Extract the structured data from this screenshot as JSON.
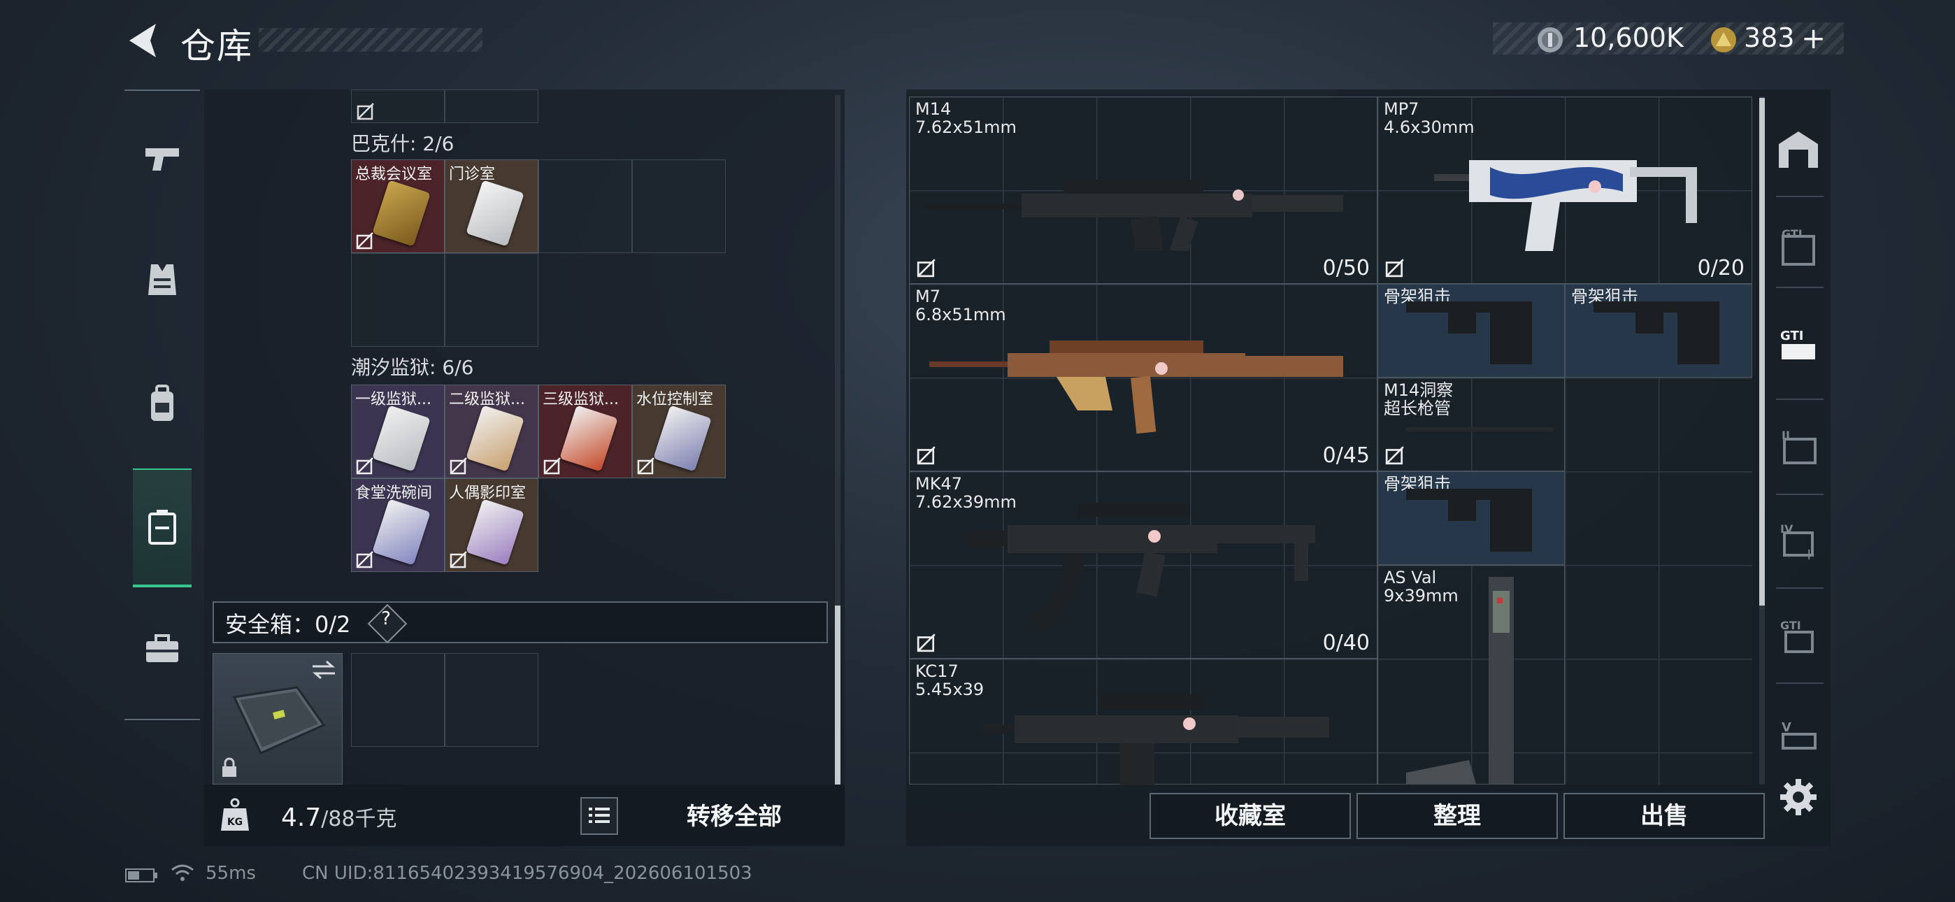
{
  "header": {
    "title": "仓库",
    "currency": [
      {
        "icon": "silver-coin-icon",
        "amount": "10,600K"
      },
      {
        "icon": "gold-coin-icon",
        "amount": "383"
      },
      {
        "add": "+"
      }
    ]
  },
  "left_nav": [
    "pistol-icon",
    "vest-icon",
    "backpack-icon",
    "container-icon",
    "toolbox-icon"
  ],
  "groups": [
    {
      "title": "巴克什: 2/6",
      "items": [
        {
          "label": "总裁会议室",
          "color": "red"
        },
        {
          "label": "门诊室",
          "color": "brown"
        }
      ]
    },
    {
      "title": "潮汐监狱: 6/6",
      "items": [
        {
          "label": "一级监狱...",
          "color": "purple"
        },
        {
          "label": "二级监狱...",
          "color": "purple"
        },
        {
          "label": "三级监狱...",
          "color": "red"
        },
        {
          "label": "水位控制室",
          "color": "brown"
        },
        {
          "label": "食堂洗碗间",
          "color": "purple"
        },
        {
          "label": "人偶影印室",
          "color": "brown"
        }
      ]
    }
  ],
  "safe_box": {
    "label": "安全箱：0/2",
    "help": "?"
  },
  "weight": {
    "current": "4.7",
    "max": "/88千克"
  },
  "transfer_all": "转移全部",
  "weapons": [
    {
      "name": "M14",
      "caliber": "7.62x51mm",
      "ammo": "0/50"
    },
    {
      "name": "MP7",
      "caliber": "4.6x30mm",
      "ammo": "0/20"
    },
    {
      "name": "M7",
      "caliber": "6.8x51mm",
      "ammo": "0/45"
    },
    {
      "name": "MK47",
      "caliber": "7.62x39mm",
      "ammo": "0/40"
    },
    {
      "name": "KC17",
      "caliber": "5.45x39"
    },
    {
      "name": "AS Val",
      "caliber": "9x39mm"
    }
  ],
  "attachments": [
    {
      "label": "骨架狙击"
    },
    {
      "label": "骨架狙击"
    },
    {
      "label": "M14洞察\n超长枪管"
    },
    {
      "label": "骨架狙击"
    }
  ],
  "bottom_buttons": {
    "collection": "收藏室",
    "sort": "整理",
    "sell": "出售"
  },
  "status": {
    "ping": "55ms",
    "uid": "CN UID:81165402393419576904_202606101503"
  },
  "colors": {
    "accent_green": "#38c68e",
    "red_card": "#4b2329",
    "purple_card": "#3b3552",
    "brown_card": "#463a30"
  }
}
